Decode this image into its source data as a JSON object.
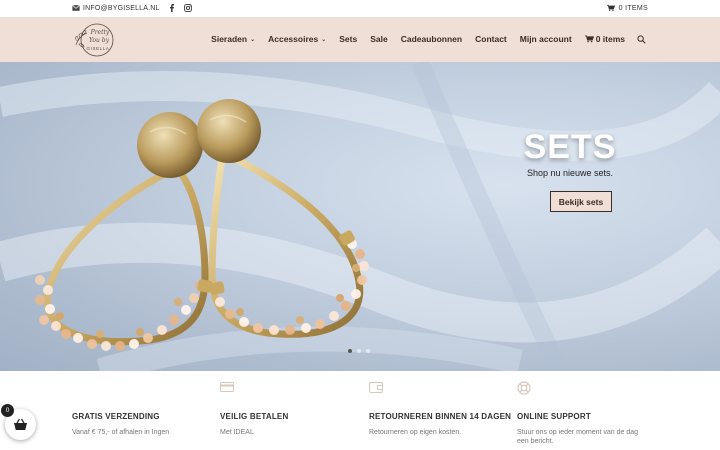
{
  "topbar": {
    "email": "INFO@BYGISELLA.NL",
    "cart_items": "0 ITEMS"
  },
  "logo": {
    "line1": "Pretty",
    "line2": "You by",
    "line3": "GISELLA"
  },
  "nav": {
    "items": [
      {
        "label": "Sieraden",
        "dropdown": true
      },
      {
        "label": "Accessoires",
        "dropdown": true
      },
      {
        "label": "Sets",
        "dropdown": false
      },
      {
        "label": "Sale",
        "dropdown": false
      },
      {
        "label": "Cadeaubonnen",
        "dropdown": false
      },
      {
        "label": "Contact",
        "dropdown": false
      },
      {
        "label": "Mijn account",
        "dropdown": false
      }
    ],
    "cart_label": "0 items"
  },
  "hero": {
    "title": "SETS",
    "subtitle": "Shop nu nieuwe sets.",
    "button_label": "Bekijk sets",
    "slides_total": 3,
    "active_slide": 1
  },
  "features": [
    {
      "icon": "truck-icon",
      "title": "GRATIS VERZENDING",
      "text": "Vanaf € 75,- of afhalen in Ingen"
    },
    {
      "icon": "credit-card-icon",
      "title": "VEILIG BETALEN",
      "text": "Met IDEAL"
    },
    {
      "icon": "wallet-icon",
      "title": "RETOURNEREN BINNEN 14 DAGEN",
      "text": "Retourneren op eigen kosten."
    },
    {
      "icon": "lifebuoy-icon",
      "title": "ONLINE SUPPORT",
      "text": "Stuur ons op ieder moment van de dag een bericht."
    }
  ],
  "floating_cart": {
    "count": "0"
  },
  "colors": {
    "header_bg": "#efdfd6",
    "text_dark": "#3a2d27",
    "button_bg": "#efdfd6"
  }
}
